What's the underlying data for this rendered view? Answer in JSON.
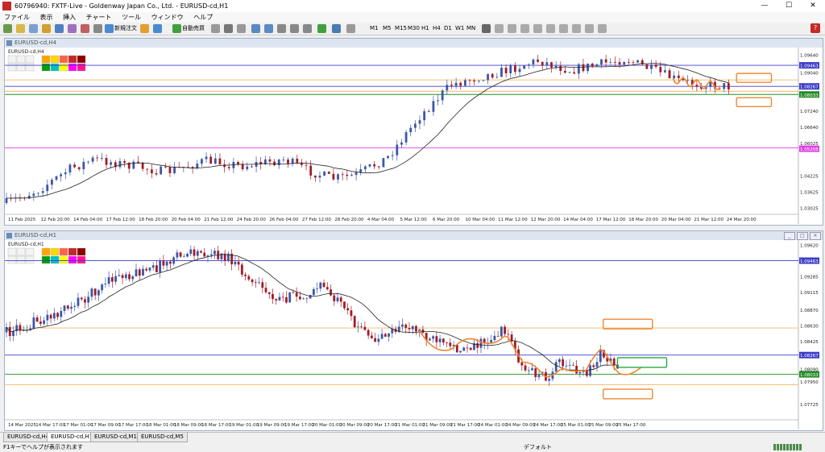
{
  "window": {
    "title": "60796940: FXTF-Live - Goldenway Japan Co., Ltd. - EURUSD-cd,H1"
  },
  "menu": [
    "ファイル",
    "表示",
    "挿入",
    "チャート",
    "ツール",
    "ウィンドウ",
    "ヘルプ"
  ],
  "toolbar": {
    "new_order": "新規注文",
    "auto_trade": "自動売買",
    "timeframes": [
      "M1",
      "M5",
      "M15",
      "M30",
      "H1",
      "H4",
      "D1",
      "W1",
      "MN"
    ]
  },
  "charts": [
    {
      "title": "EURUSD-cd,H4",
      "label": "EURUSD-cd,H4",
      "price_labels": [
        "1.09640",
        "1.09463",
        "1.09040",
        "1.08267",
        "1.08033",
        "1.07240",
        "1.06640",
        "1.06025",
        "1.05208",
        "1.04225",
        "1.03625",
        "1.03025"
      ],
      "time_labels": [
        "11 Feb 2025",
        "12 Feb 20:00",
        "14 Feb 04:00",
        "17 Feb 12:00",
        "18 Feb 20:00",
        "20 Feb 04:00",
        "21 Feb 12:00",
        "24 Feb 20:00",
        "26 Feb 04:00",
        "27 Feb 12:00",
        "28 Feb 20:00",
        "4 Mar 04:00",
        "5 Mar 12:00",
        "6 Mar 20:00",
        "10 Mar 04:00",
        "11 Mar 12:00",
        "12 Mar 20:00",
        "14 Mar 04:00",
        "17 Mar 12:00",
        "18 Mar 20:00",
        "20 Mar 04:00",
        "21 Mar 12:00",
        "24 Mar 20:00"
      ],
      "levels": [
        {
          "price": "1.09463",
          "color": "#3c3cc8"
        },
        {
          "price": "1.08267",
          "color": "#3c3cc8"
        },
        {
          "price": "1.08033",
          "color": "#228b22"
        },
        {
          "price": "1.05208",
          "color": "#e040e0"
        }
      ],
      "colors": {
        "bull": "#3a57a8",
        "bear": "#a01c28",
        "ma": "#222222",
        "annot": "#ee8833"
      }
    },
    {
      "title": "EURUSD-cd,H1",
      "label": "EURUSD-cd,H1",
      "price_labels": [
        "1.09620",
        "1.09463",
        "1.09285",
        "1.09115",
        "1.08870",
        "1.08630",
        "1.08425",
        "1.08267",
        "1.08090",
        "1.08033",
        "1.07950",
        "1.07725"
      ],
      "time_labels": [
        "14 Mar 2025",
        "14 Mar 17:00",
        "17 Mar 01:00",
        "17 Mar 09:00",
        "17 Mar 17:00",
        "18 Mar 01:00",
        "18 Mar 09:00",
        "18 Mar 17:00",
        "19 Mar 01:00",
        "19 Mar 09:00",
        "19 Mar 17:00",
        "20 Mar 01:00",
        "20 Mar 09:00",
        "20 Mar 17:00",
        "21 Mar 01:00",
        "21 Mar 09:00",
        "21 Mar 17:00",
        "24 Mar 01:00",
        "24 Mar 09:00",
        "24 Mar 17:00",
        "25 Mar 01:00",
        "25 Mar 09:00",
        "25 Mar 17:00"
      ],
      "levels": [
        {
          "price": "1.09463",
          "color": "#3c3cc8"
        },
        {
          "price": "1.08267",
          "color": "#3c3cc8"
        },
        {
          "price": "1.08033",
          "color": "#228b22"
        }
      ],
      "colors": {
        "bull": "#3a57a8",
        "bear": "#a01c28",
        "ma": "#222222",
        "annot": "#ee8833"
      }
    }
  ],
  "tabs": [
    "EURUSD-cd,H4",
    "EURUSD-cd,H1",
    "EURUSD-cd,M15",
    "EURUSD-cd,M5"
  ],
  "status": {
    "help": "F1キーでヘルプが表示されます",
    "profile": "デフォルト"
  }
}
